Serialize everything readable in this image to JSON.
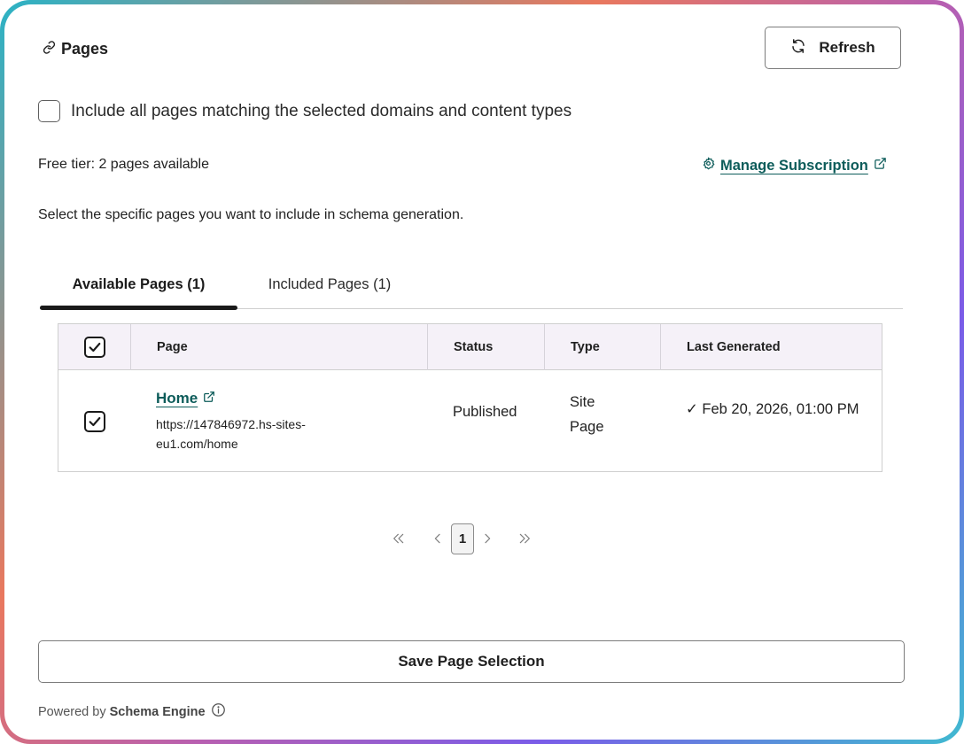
{
  "header": {
    "title": "Pages",
    "refresh_label": "Refresh"
  },
  "include_all": {
    "label": "Include all pages matching the selected domains and content types",
    "checked": false
  },
  "free_tier_text": "Free tier: 2 pages available",
  "manage_subscription_label": "Manage Subscription",
  "select_info": "Select the specific pages you want to include in schema generation.",
  "tabs": [
    {
      "label": "Available Pages (1)",
      "active": true
    },
    {
      "label": "Included Pages (1)",
      "active": false
    }
  ],
  "table": {
    "headers": {
      "page": "Page",
      "status": "Status",
      "type": "Type",
      "last_generated": "Last Generated"
    },
    "header_checked": true,
    "rows": [
      {
        "checked": true,
        "page_name": "Home",
        "url": "https://147846972.hs-sites-eu1.com/home",
        "status": "Published",
        "type": "Site Page",
        "last_generated": "✓ Feb 20, 2026, 01:00 PM"
      }
    ]
  },
  "pagination": {
    "current_page": "1"
  },
  "save_label": "Save Page Selection",
  "footer": {
    "powered_by": "Powered by",
    "brand": "Schema Engine"
  },
  "colors": {
    "link": "#0d5c5a",
    "header_bg": "#f5f1f8"
  }
}
